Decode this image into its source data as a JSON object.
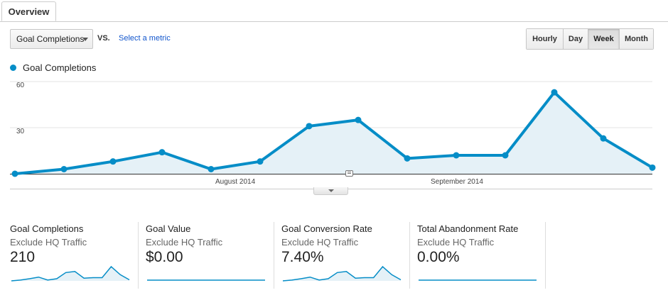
{
  "tabs": {
    "overview": "Overview"
  },
  "controls": {
    "metric_select": "Goal Completions",
    "vs_label": "VS.",
    "select_metric_link": "Select a metric",
    "granularity": [
      "Hourly",
      "Day",
      "Week",
      "Month"
    ],
    "selected_granularity": "Week"
  },
  "colors": {
    "series": "#058dc7",
    "fill": "#e5f1f7",
    "link": "#1155cc"
  },
  "chart_data": {
    "type": "area",
    "series": [
      {
        "name": "Goal Completions",
        "values": [
          0,
          3,
          8,
          14,
          3,
          8,
          31,
          35,
          10,
          12,
          12,
          53,
          23,
          4
        ]
      }
    ],
    "x_tick_labels": [
      "August 2014",
      "September 2014"
    ],
    "y_ticks": [
      30,
      60
    ],
    "ylim": [
      0,
      60
    ],
    "grid": true
  },
  "scorecards": [
    {
      "title": "Goal Completions",
      "segment": "Exclude HQ Traffic",
      "value": "210",
      "sparkline": [
        0,
        3,
        8,
        14,
        3,
        8,
        31,
        35,
        10,
        12,
        12,
        53,
        23,
        4
      ]
    },
    {
      "title": "Goal Value",
      "segment": "Exclude HQ Traffic",
      "value": "$0.00",
      "sparkline": [
        0,
        0,
        0,
        0,
        0,
        0,
        0,
        0,
        0,
        0,
        0,
        0,
        0,
        0
      ]
    },
    {
      "title": "Goal Conversion Rate",
      "segment": "Exclude HQ Traffic",
      "value": "7.40%",
      "sparkline": [
        0,
        3,
        8,
        14,
        3,
        8,
        31,
        35,
        10,
        12,
        12,
        53,
        23,
        4
      ]
    },
    {
      "title": "Total Abandonment Rate",
      "segment": "Exclude HQ Traffic",
      "value": "0.00%",
      "sparkline": [
        0,
        0,
        0,
        0,
        0,
        0,
        0,
        0,
        0,
        0,
        0,
        0,
        0,
        0
      ]
    }
  ]
}
